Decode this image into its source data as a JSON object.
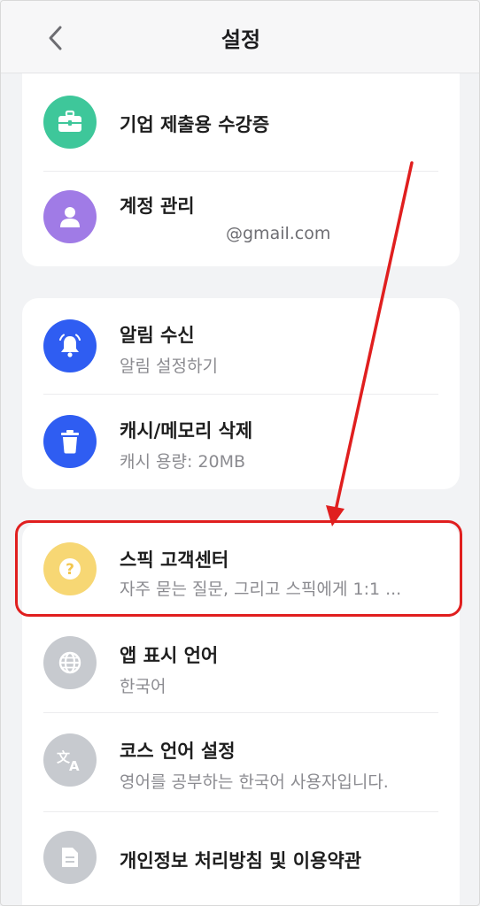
{
  "header": {
    "title": "설정",
    "back_icon": "chevron-left-icon"
  },
  "groups": [
    {
      "items": [
        {
          "title": "기업 제출용 수강증",
          "subtitle": "",
          "icon": "briefcase-icon",
          "color": "#3ec79a"
        },
        {
          "title": "계정 관리",
          "subtitle": "@gmail.com",
          "icon": "user-icon",
          "color": "#a07be6"
        }
      ]
    },
    {
      "items": [
        {
          "title": "알림 수신",
          "subtitle": "알림 설정하기",
          "icon": "bell-icon",
          "color": "#2f5df2"
        },
        {
          "title": "캐시/메모리 삭제",
          "subtitle": "캐시 용량: 20MB",
          "icon": "trash-icon",
          "color": "#2f5df2"
        }
      ]
    },
    {
      "items": [
        {
          "title": "스픽 고객센터",
          "subtitle": "자주 묻는 질문, 그리고 스픽에게 1:1 ...",
          "icon": "question-icon",
          "color": "#f7d774"
        },
        {
          "title": "앱 표시 언어",
          "subtitle": "한국어",
          "icon": "globe-icon",
          "color": "#c7cacf"
        },
        {
          "title": "코스 언어 설정",
          "subtitle": "영어를 공부하는 한국어 사용자입니다.",
          "icon": "translate-icon",
          "color": "#c7cacf"
        },
        {
          "title": "개인정보 처리방침 및 이용약관",
          "subtitle": "",
          "icon": "document-icon",
          "color": "#c7cacf"
        }
      ]
    }
  ],
  "annotation": {
    "color": "#e01f1f"
  }
}
